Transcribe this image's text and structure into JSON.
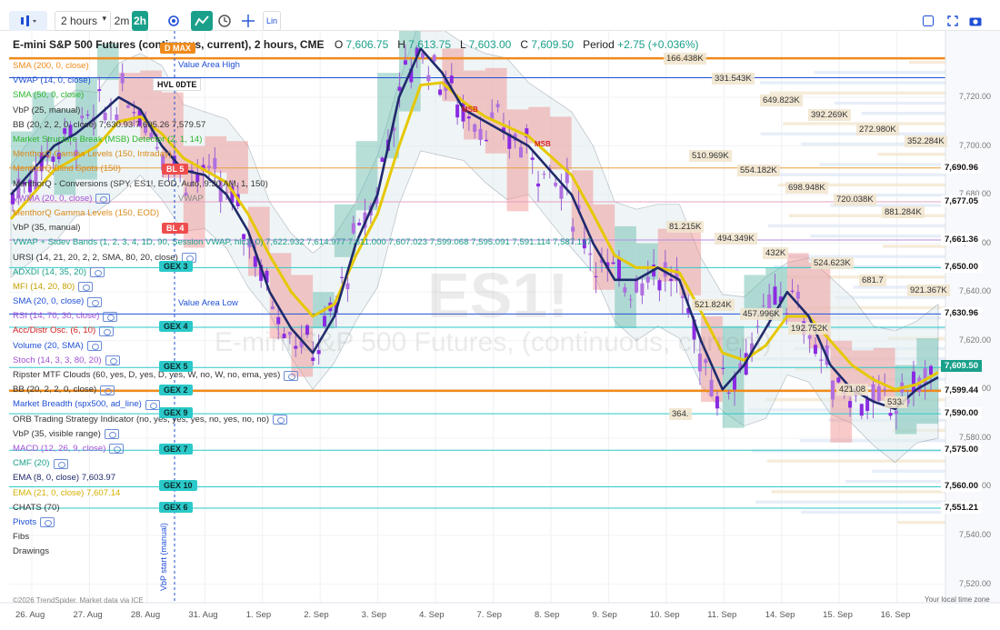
{
  "toolbar": {
    "interval": "2 hours",
    "quick_2m": "2m",
    "quick_2h": "2h",
    "lin": "Lin"
  },
  "title": {
    "name": "E-mini S&P 500 Futures (continuous, current), 2 hours, CME",
    "o_label": "O",
    "o": "7,606.75",
    "h_label": "H",
    "h": "7,613.75",
    "l_label": "L",
    "l": "7,603.00",
    "c_label": "C",
    "c": "7,609.50",
    "period_label": "Period",
    "period": "+2.75 (+0.036%)"
  },
  "indicators": [
    {
      "text": "SMA (200, 0, close)",
      "color": "#f08a1a"
    },
    {
      "text": "VWAP (14, 0, close)",
      "color": "#1f4fd6"
    },
    {
      "text": "SMA (50, 0, close)",
      "color": "#2ab52a"
    },
    {
      "text": "VbP (25, manual)",
      "color": "#333333"
    },
    {
      "text": "BB (20, 2, 2, 0, close)  7,630.93  7,605.26  7,579.57",
      "color": "#333333"
    },
    {
      "text": "Market Structure Break (MSB) Detector (2, 1, 14)",
      "color": "#2ab52a"
    },
    {
      "text": "MenthorQ Gamma Levels (150, Intraday)",
      "color": "#d98a1a"
    },
    {
      "text": "MenthorQ Blind Spots (150)",
      "color": "#d98a1a"
    },
    {
      "text": "MenthorQ - Conversions (SPY, ES1!, EOD, Auto, 9:30 AM, 1, 150)",
      "color": "#333333"
    },
    {
      "text": "VWMA (20, 0, close)",
      "color": "#a34fd6",
      "eye": true
    },
    {
      "text": "MenthorQ Gamma Levels (150, EOD)",
      "color": "#d98a1a"
    },
    {
      "text": "VbP (35, manual)",
      "color": "#333333"
    },
    {
      "text": "VWAP + Stdev Bands (1, 2, 3, 4, 1D, 90, Session VWAP, hlc3, 0)  7,622.932  7,614.977  7,611.000  7,607.023  7,599.068  7,595.091  7,591.114  7,587.137",
      "color": "#1aa08a"
    },
    {
      "text": "URSI (14, 21, 20, 2, 2, SMA, 80, 20, close)",
      "color": "#333333",
      "eye": true
    },
    {
      "text": "ADXDI (14, 35, 20)",
      "color": "#1aa08a",
      "eye": true
    },
    {
      "text": "MFI (14, 20, 80)",
      "color": "#c4a000",
      "eye": true
    },
    {
      "text": "SMA (20, 0, close)",
      "color": "#1f4fd6",
      "eye": true
    },
    {
      "text": "RSI (14, 70, 30, close)",
      "color": "#a34fd6",
      "eye": true
    },
    {
      "text": "Acc/Distr Osc. (6, 10)",
      "color": "#d42020",
      "eye": true
    },
    {
      "text": "Volume (20, SMA)",
      "color": "#1f4fd6",
      "eye": true
    },
    {
      "text": "Stoch (14, 3, 3, 80, 20)",
      "color": "#a34fd6",
      "eye": true
    },
    {
      "text": "Ripster MTF Clouds (60, yes, D, yes, D, yes, W, no, W, no, ema, yes)",
      "color": "#333333",
      "eye": true
    },
    {
      "text": "BB (20, 2, 2, 0, close)",
      "color": "#333333",
      "eye": true
    },
    {
      "text": "Market Breadth (spx500, ad_line)",
      "color": "#1f4fd6",
      "eye": true
    },
    {
      "text": "ORB Trading Strategy Indicator (no, yes, yes, yes, no, yes, no, no)",
      "color": "#333333",
      "eye": true
    },
    {
      "text": "VbP (35, visible range)",
      "color": "#333333",
      "eye": true
    },
    {
      "text": "MACD (12, 26, 9, close)",
      "color": "#a34fd6",
      "eye": true
    },
    {
      "text": "CMF (20)",
      "color": "#1aa08a",
      "eye": true
    },
    {
      "text": "EMA (8, 0, close)  7,603.97",
      "color": "#1f2a6b"
    },
    {
      "text": "EMA (21, 0, close)  7,607.14",
      "color": "#d4b000"
    },
    {
      "text": "CHATS (70)",
      "color": "#333333"
    },
    {
      "text": "Pivots",
      "color": "#1f4fd6",
      "eye": true
    },
    {
      "text": "Fibs",
      "color": "#333333"
    },
    {
      "text": "Drawings",
      "color": "#333333"
    }
  ],
  "price_labels": [
    {
      "text": "7,690.96",
      "y": 7690.96,
      "bg": "#ffffff",
      "fg": "#111111"
    },
    {
      "text": "7,677.05",
      "y": 7677.05,
      "bg": "#ffffff",
      "fg": "#111111"
    },
    {
      "text": "7,661.36",
      "y": 7661.36,
      "bg": "#ffffff",
      "fg": "#111111"
    },
    {
      "text": "7,650.00",
      "y": 7650.0,
      "bg": "#ffffff",
      "fg": "#111111"
    },
    {
      "text": "7,630.96",
      "y": 7630.96,
      "bg": "#ffffff",
      "fg": "#111111"
    },
    {
      "text": "7,609.50",
      "y": 7609.5,
      "bg": "#1aa08a",
      "fg": "#ffffff"
    },
    {
      "text": "7,599.44",
      "y": 7599.44,
      "bg": "#ffffff",
      "fg": "#111111"
    },
    {
      "text": "7,590.00",
      "y": 7590.0,
      "bg": "#ffffff",
      "fg": "#111111"
    },
    {
      "text": "7,575.00",
      "y": 7575.0,
      "bg": "#ffffff",
      "fg": "#111111"
    },
    {
      "text": "7,560.00",
      "y": 7560.0,
      "bg": "#ffffff",
      "fg": "#111111"
    },
    {
      "text": "7,551.21",
      "y": 7551.21,
      "bg": "#ffffff",
      "fg": "#111111"
    }
  ],
  "axis_ticks": [
    {
      "text": "7,720.00",
      "y": 7720
    },
    {
      "text": "7,700.00",
      "y": 7700
    },
    {
      "text": "7,680.00",
      "y": 7680
    },
    {
      "text": "7,660.00",
      "y": 7660
    },
    {
      "text": "7,640.00",
      "y": 7640
    },
    {
      "text": "7,620.00",
      "y": 7620
    },
    {
      "text": "7,600.00",
      "y": 7600
    },
    {
      "text": "7,580.00",
      "y": 7580
    },
    {
      "text": "7,560.00",
      "y": 7560
    },
    {
      "text": "7,540.00",
      "y": 7540
    },
    {
      "text": "7,520.00",
      "y": 7520
    }
  ],
  "x_ticks": [
    "26. Aug",
    "27. Aug",
    "28. Aug",
    "31. Aug",
    "1. Sep",
    "2. Sep",
    "3. Sep",
    "4. Sep",
    "7. Sep",
    "8. Sep",
    "9. Sep",
    "10. Sep",
    "11. Sep",
    "14. Sep",
    "15. Sep",
    "16. Sep"
  ],
  "volume_labels": [
    {
      "text": "166.438K",
      "y": 7736
    },
    {
      "text": "331.543K",
      "y": 7728
    },
    {
      "text": "649.823K",
      "y": 7719
    },
    {
      "text": "392.269K",
      "y": 7713
    },
    {
      "text": "272.980K",
      "y": 7707
    },
    {
      "text": "352.284K",
      "y": 7702
    },
    {
      "text": "510.969K",
      "y": 7696
    },
    {
      "text": "554.182K",
      "y": 7690
    },
    {
      "text": "698.948K",
      "y": 7683
    },
    {
      "text": "720.038K",
      "y": 7678
    },
    {
      "text": "881.284K",
      "y": 7673
    },
    {
      "text": "81.215K",
      "y": 7667
    },
    {
      "text": "494.349K",
      "y": 7662
    },
    {
      "text": "432K",
      "y": 7656
    },
    {
      "text": "524.623K",
      "y": 7652
    },
    {
      "text": "681.7",
      "y": 7645
    },
    {
      "text": "921.367K",
      "y": 7641
    },
    {
      "text": "521.824K",
      "y": 7635
    },
    {
      "text": "457.996K",
      "y": 7631
    },
    {
      "text": "192.752K",
      "y": 7625
    },
    {
      "text": "421.08",
      "y": 7600
    },
    {
      "text": "533.",
      "y": 7595
    },
    {
      "text": "364.",
      "y": 7590
    }
  ],
  "gex_levels": [
    {
      "text": "GEX 3",
      "y": 7650.0
    },
    {
      "text": "GEX 4",
      "y": 7625.5
    },
    {
      "text": "GEX 5",
      "y": 7609.0
    },
    {
      "text": "GEX 2",
      "y": 7599.4
    },
    {
      "text": "GEX 9",
      "y": 7590.0
    },
    {
      "text": "GEX 7",
      "y": 7575.0
    },
    {
      "text": "GEX 10",
      "y": 7560.0
    },
    {
      "text": "GEX 6",
      "y": 7551.2
    }
  ],
  "bl_levels": [
    {
      "text": "BL 5",
      "y": 7690.0
    },
    {
      "text": "BL 4",
      "y": 7666.0
    }
  ],
  "misc_labels": {
    "hvl": "HVL 0DTE",
    "value_area_high": "Value Area High",
    "value_area_low": "Value Area Low",
    "vwap": "VWAP",
    "msb1": "MSB",
    "msb2": "MSB",
    "d_max": "D MAX",
    "vbp_start": "VbP start (manual)",
    "watermark_symbol": "ES1!",
    "watermark_name": "E-mini S&P 500 Futures, (continuous, current)",
    "copyright": "©2026 TrendSpider. Market data via ICE",
    "timezone": "Your local time zone"
  },
  "colors": {
    "bull": "#1aa08a",
    "bear": "#ef4d4d",
    "ema8": "#1f2a6b",
    "ema21": "#e6c800",
    "vwap_line": "#1f4fd6",
    "gex": "#2bc9c9",
    "sma200": "#f08a1a"
  },
  "chart_data": {
    "type": "candlestick",
    "y_range": [
      7515,
      7745
    ],
    "ema8_path": [
      7680,
      7690,
      7700,
      7705,
      7712,
      7720,
      7715,
      7700,
      7690,
      7688,
      7680,
      7665,
      7640,
      7625,
      7615,
      7630,
      7660,
      7680,
      7720,
      7740,
      7730,
      7715,
      7710,
      7705,
      7700,
      7690,
      7680,
      7660,
      7645,
      7645,
      7650,
      7645,
      7620,
      7600,
      7610,
      7625,
      7640,
      7630,
      7610,
      7600,
      7595,
      7592,
      7600,
      7605
    ],
    "ema21_path": [
      7670,
      7680,
      7690,
      7695,
      7700,
      7710,
      7712,
      7705,
      7695,
      7690,
      7685,
      7672,
      7655,
      7640,
      7630,
      7635,
      7655,
      7672,
      7700,
      7725,
      7726,
      7718,
      7712,
      7708,
      7704,
      7696,
      7688,
      7672,
      7655,
      7650,
      7650,
      7648,
      7632,
      7615,
      7612,
      7618,
      7630,
      7630,
      7620,
      7610,
      7604,
      7600,
      7602,
      7607
    ]
  }
}
